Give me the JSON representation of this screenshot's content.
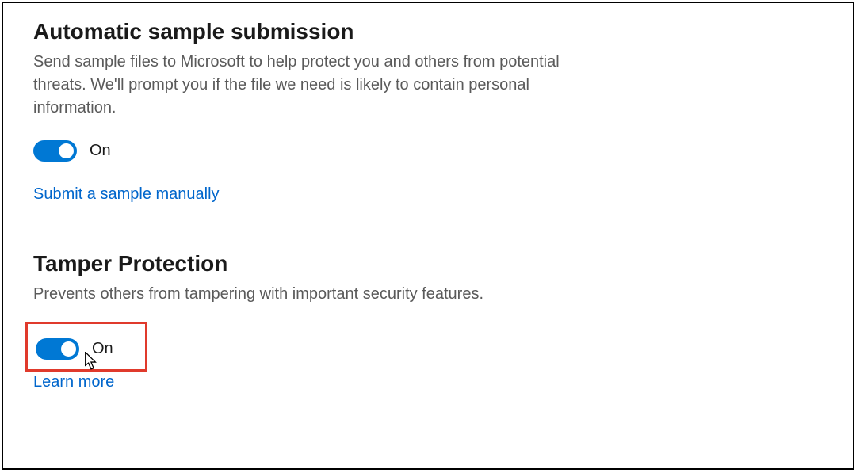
{
  "sections": {
    "sample_submission": {
      "title": "Automatic sample submission",
      "description": "Send sample files to Microsoft to help protect you and others from potential threats. We'll prompt you if the file we need is likely to contain personal information.",
      "toggle_state": "On",
      "link": "Submit a sample manually"
    },
    "tamper_protection": {
      "title": "Tamper Protection",
      "description": "Prevents others from tampering with important security features.",
      "toggle_state": "On",
      "link": "Learn more"
    }
  }
}
